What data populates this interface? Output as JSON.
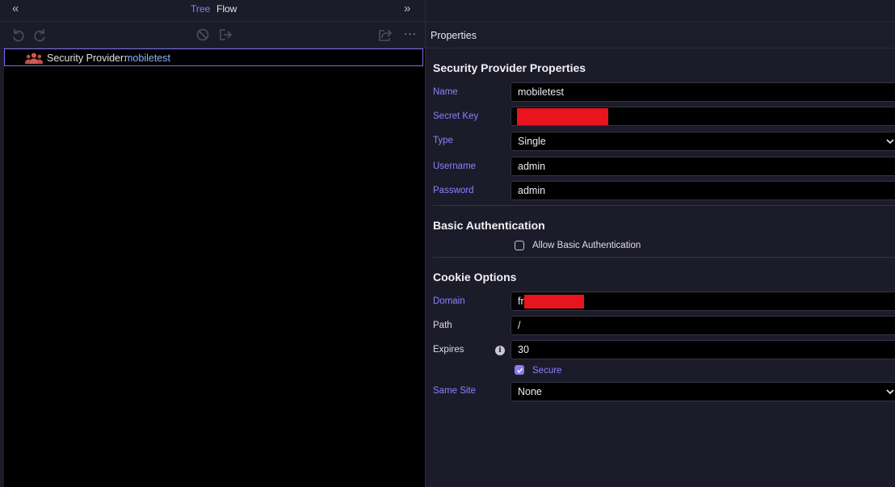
{
  "left_panel": {
    "tabs": {
      "tree": "Tree",
      "flow": "Flow"
    },
    "collapse_left_glyph": "«",
    "collapse_right_glyph": "»",
    "more_glyph": "···",
    "toolbar_icons": [
      "undo-icon",
      "redo-icon",
      "disable-icon",
      "export-icon",
      "share-icon"
    ],
    "tree_item": {
      "type": "Security Provider:",
      "name": "mobiletest",
      "icon": "users-icon"
    }
  },
  "properties": {
    "header": "Properties",
    "section_provider": "Security Provider Properties",
    "name_label": "Name",
    "name_value": "mobiletest",
    "secret_key_label": "Secret Key",
    "type_label": "Type",
    "type_value": "Single",
    "username_label": "Username",
    "username_value": "admin",
    "password_label": "Password",
    "password_value": "admin",
    "section_basic_auth": "Basic Authentication",
    "allow_basic_auth_label": "Allow Basic Authentication",
    "allow_basic_auth_checked": false,
    "section_cookie": "Cookie Options",
    "domain_label": "Domain",
    "domain_value": "fr",
    "path_label": "Path",
    "path_value": "/",
    "expires_label": "Expires",
    "expires_value": "30",
    "secure_label": "Secure",
    "secure_checked": true,
    "same_site_label": "Same Site",
    "same_site_value": "None"
  },
  "colors": {
    "accent": "#8b7cff",
    "redaction": "#e8141e",
    "background": "#1c1b29",
    "field_background": "#000000"
  }
}
